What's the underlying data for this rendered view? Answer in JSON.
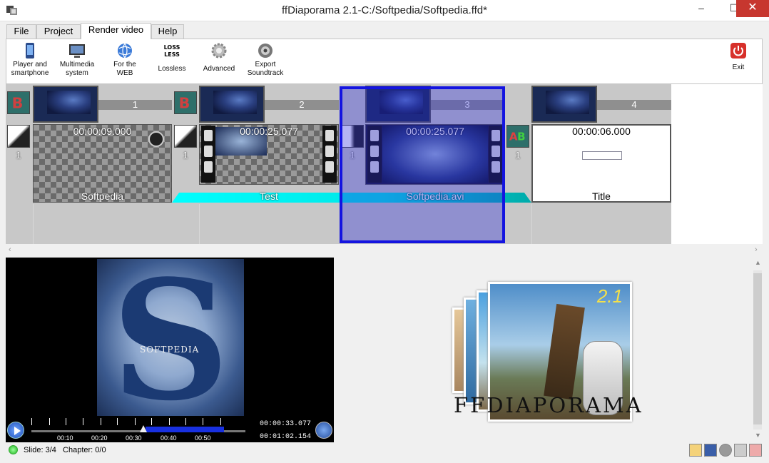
{
  "window": {
    "title": "ffDiaporama 2.1-C:/Softpedia/Softpedia.ffd*",
    "minimize_glyph": "–",
    "maximize_glyph": "☐",
    "close_glyph": "✕"
  },
  "menu_tabs": [
    {
      "label": "File"
    },
    {
      "label": "Project"
    },
    {
      "label": "Render video"
    },
    {
      "label": "Help"
    }
  ],
  "ribbon": {
    "buttons": [
      {
        "label": "Player and smartphone",
        "icon": "smartphone-icon"
      },
      {
        "label": "Multimedia system",
        "icon": "monitor-icon"
      },
      {
        "label": "For the WEB",
        "icon": "web-globe-icon"
      },
      {
        "label": "Lossless",
        "icon": "lossless-icon"
      },
      {
        "label": "Advanced",
        "icon": "gear-icon"
      },
      {
        "label": "Export Soundtrack",
        "icon": "speaker-icon"
      }
    ],
    "exit_label": "Exit"
  },
  "timeline": {
    "slides": [
      {
        "number": "1",
        "duration": "00:00:09.000",
        "name": "Softpedia",
        "transition_count": "1"
      },
      {
        "number": "2",
        "duration": "00:00:25.077",
        "name": "Test",
        "transition_count": "1"
      },
      {
        "number": "3",
        "duration": "00:00:25.077",
        "name": "Softpedia.avi",
        "transition_count": "1"
      },
      {
        "number": "4",
        "duration": "00:00:06.000",
        "name": "Title",
        "transition_count": "1"
      }
    ],
    "selected_index": 3
  },
  "preview": {
    "watermark": "SOFTPEDIA",
    "current_time": "00:00:33.077",
    "total_time": "00:01:02.154",
    "ruler_labels": [
      "00:10",
      "00:20",
      "00:30",
      "00:40",
      "00:50"
    ]
  },
  "logo": {
    "version": "2.1",
    "name": "FFDIAPORAMA"
  },
  "status": {
    "slide": "Slide: 3/4",
    "chapter": "Chapter: 0/0"
  }
}
